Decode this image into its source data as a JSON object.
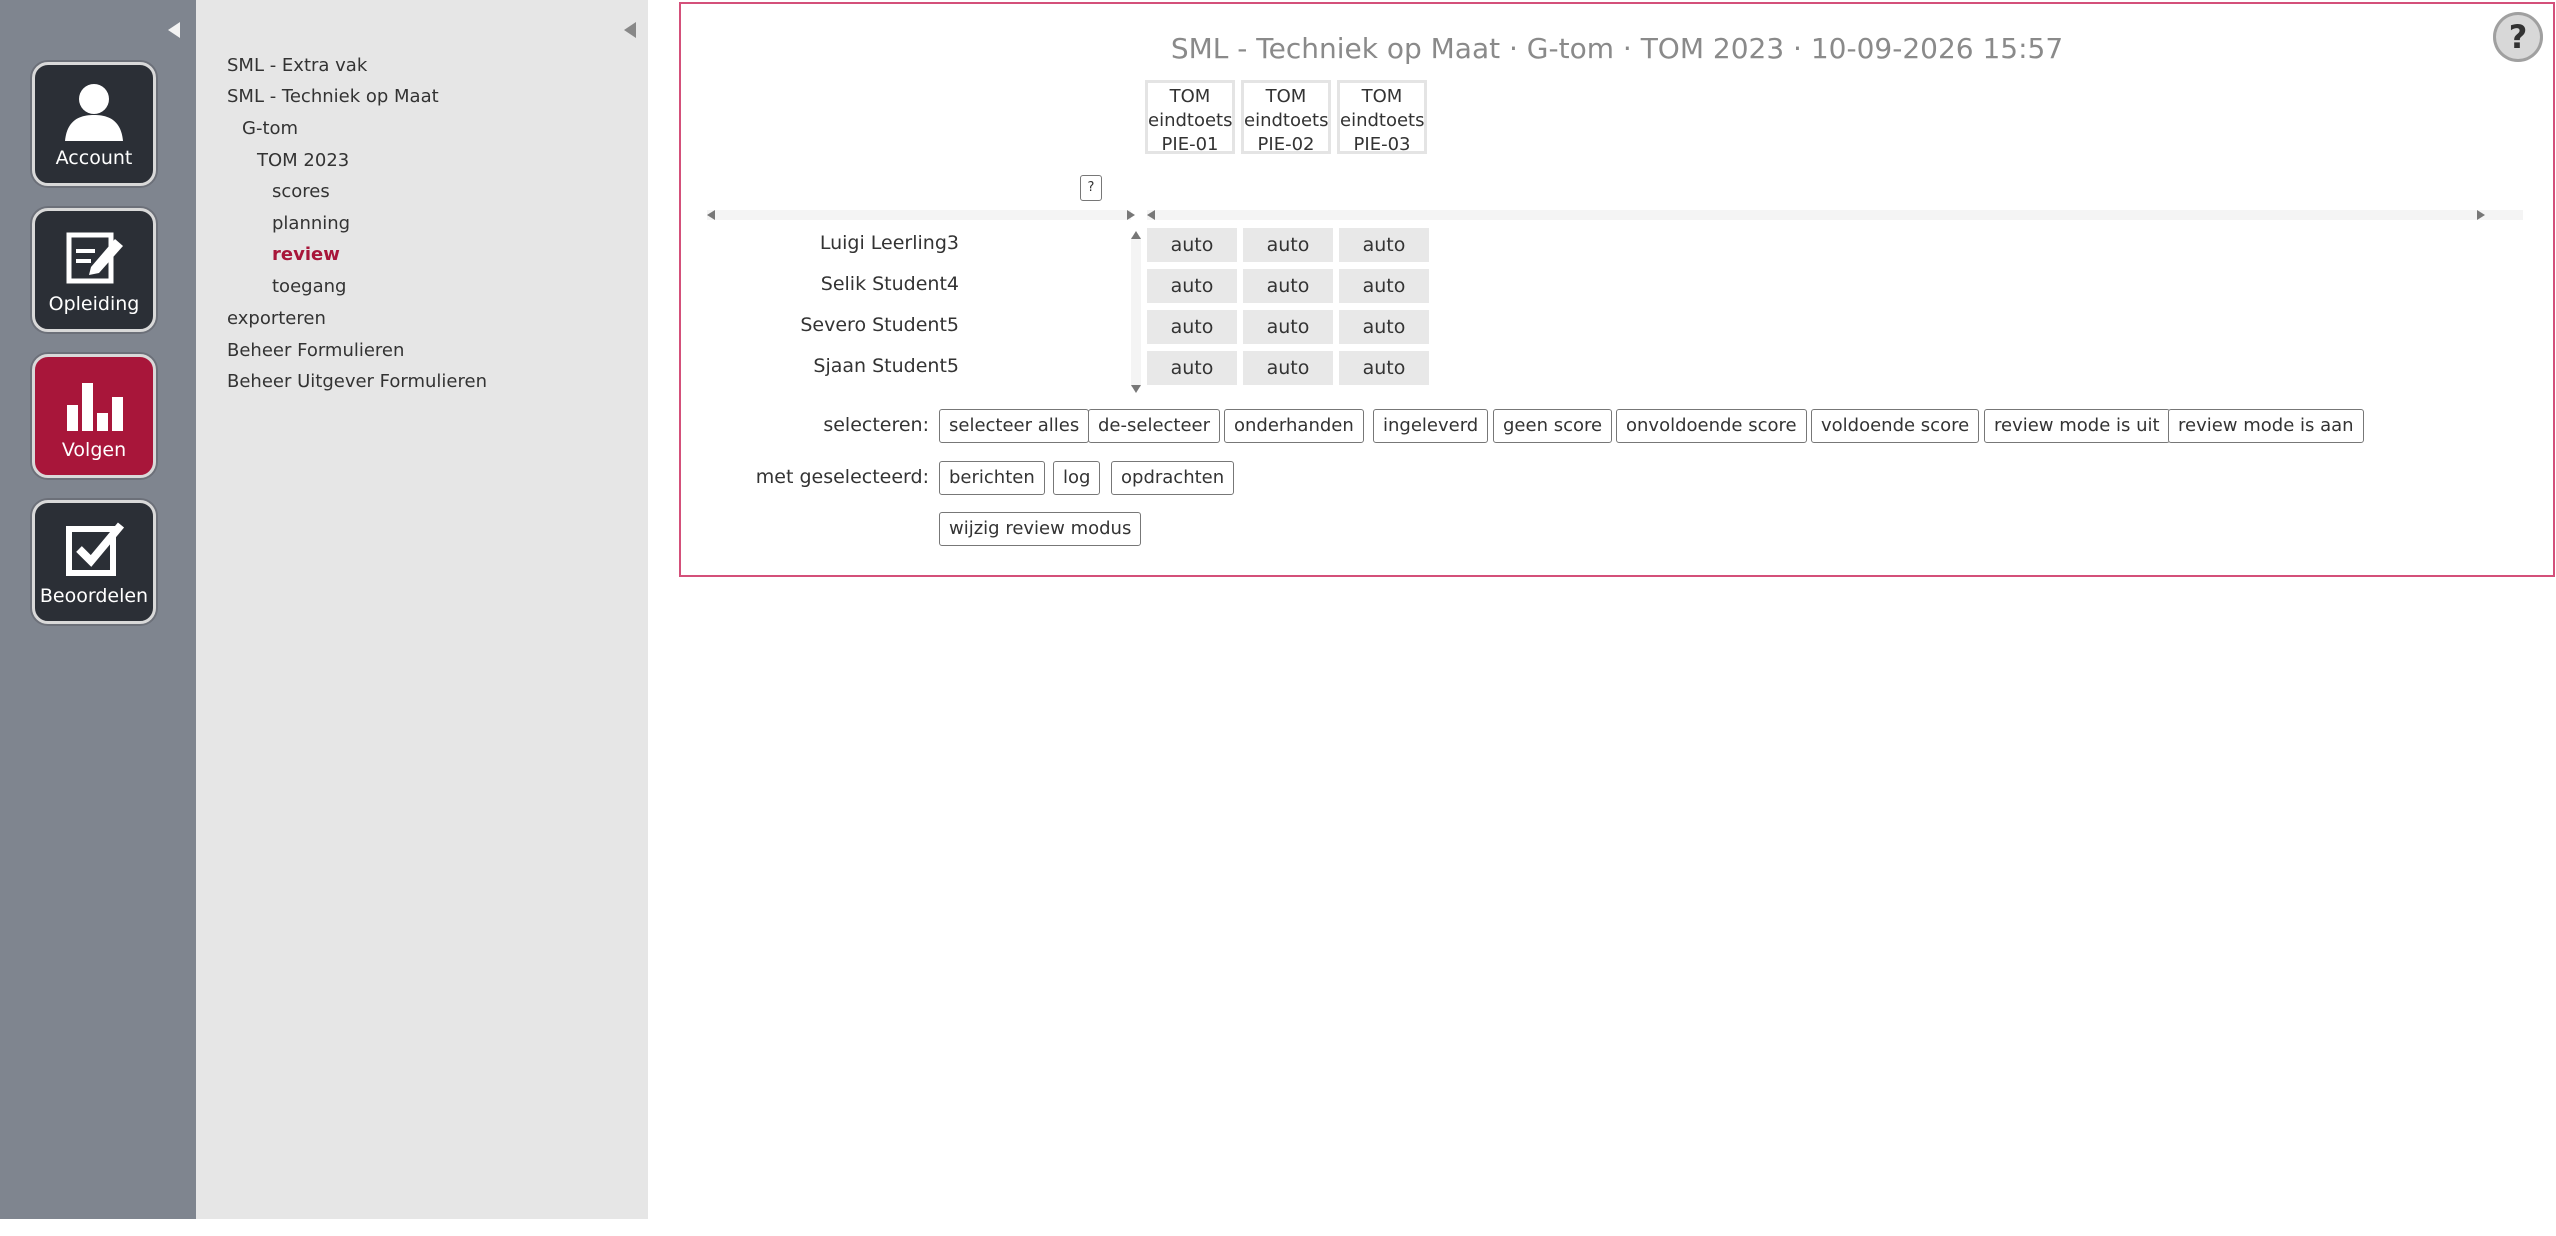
{
  "rail": {
    "items": [
      {
        "label": "Account",
        "icon": "user-icon"
      },
      {
        "label": "Opleiding",
        "icon": "edit-icon"
      },
      {
        "label": "Volgen",
        "icon": "bar-chart-icon",
        "active": true
      },
      {
        "label": "Beoordelen",
        "icon": "checkbox-icon"
      }
    ]
  },
  "tree": {
    "items": [
      {
        "label": "SML - Extra vak"
      },
      {
        "label": "SML - Techniek op Maat"
      },
      {
        "label": "G-tom"
      },
      {
        "label": "TOM 2023"
      },
      {
        "label": "scores"
      },
      {
        "label": "planning"
      },
      {
        "label": "review",
        "active": true
      },
      {
        "label": "toegang"
      },
      {
        "label": "exporteren"
      },
      {
        "label": "Beheer Formulieren"
      },
      {
        "label": "Beheer Uitgever Formulieren"
      }
    ]
  },
  "main": {
    "title": "SML - Techniek op Maat · G-tom · TOM 2023 · 10-09-2026 15:57",
    "help_label": "?",
    "mini_help_label": "?",
    "columns": [
      {
        "line1": "TOM",
        "line2": "eindtoets",
        "line3": "PIE-01"
      },
      {
        "line1": "TOM",
        "line2": "eindtoets",
        "line3": "PIE-02"
      },
      {
        "line1": "TOM",
        "line2": "eindtoets",
        "line3": "PIE-03"
      }
    ],
    "rows": [
      {
        "name": "Luigi Leerling3",
        "cells": [
          "auto",
          "auto",
          "auto"
        ]
      },
      {
        "name": "Selik Student4",
        "cells": [
          "auto",
          "auto",
          "auto"
        ]
      },
      {
        "name": "Severo Student5",
        "cells": [
          "auto",
          "auto",
          "auto"
        ]
      },
      {
        "name": "Sjaan Student5",
        "cells": [
          "auto",
          "auto",
          "auto"
        ]
      }
    ]
  },
  "selection": {
    "label": "selecteren:",
    "buttons": [
      "selecteer alles",
      "de-selecteer",
      "onderhanden",
      "ingeleverd",
      "geen score",
      "onvoldoende score",
      "voldoende score",
      "review mode is uit",
      "review mode is aan"
    ]
  },
  "actions": {
    "label": "met geselecteerd:",
    "buttons": [
      "berichten",
      "log",
      "opdrachten"
    ],
    "second_row": [
      "wijzig review modus"
    ]
  },
  "colors": {
    "accent": "#a8163a",
    "panel_border": "#d4507a",
    "rail_bg": "#7f858f",
    "tree_bg": "#e6e6e6",
    "cell_bg": "#e8e8e8"
  }
}
